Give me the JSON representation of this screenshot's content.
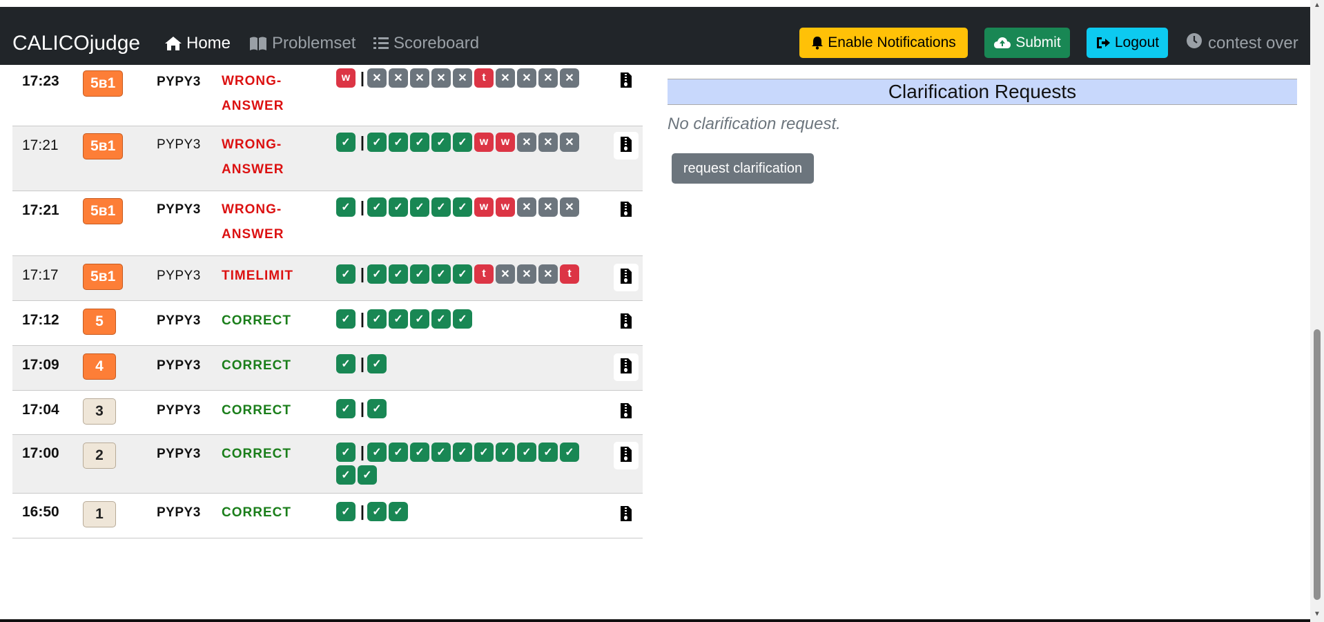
{
  "navbar": {
    "brand": "CALICOjudge",
    "home_label": "Home",
    "problemset_label": "Problemset",
    "scoreboard_label": "Scoreboard",
    "notifications_label": "Enable Notifications",
    "submit_label": "Submit",
    "logout_label": "Logout",
    "status": "contest over",
    "icons": {
      "home": "home-icon",
      "problemset": "book-icon",
      "scoreboard": "list-icon",
      "notifications": "bell-icon",
      "submit": "cloud-upload-icon",
      "logout": "sign-out-icon",
      "status": "clock-icon"
    }
  },
  "colors": {
    "navbar_bg": "#212529",
    "warning": "#ffc107",
    "success": "#198754",
    "info": "#0dcaf0",
    "problem_orange": "#fd7e37",
    "problem_beige": "#efe6d8",
    "wrong": "#dc1111",
    "correct": "#1a7e1a",
    "clarification_header": "#c8d8fc"
  },
  "submissions": {
    "rows": [
      {
        "time": "17:23",
        "problem": "5в1",
        "language": "PYPY3",
        "verdict": [
          "WRONG-",
          "ANSWER"
        ]
      },
      {
        "time": "17:21",
        "problem": "5в1",
        "language": "PYPY3",
        "verdict": [
          "WRONG-",
          "ANSWER"
        ]
      },
      {
        "time": "17:21",
        "problem": "5в1",
        "language": "PYPY3",
        "verdict": [
          "WRONG-",
          "ANSWER"
        ]
      },
      {
        "time": "17:17",
        "problem": "5в1",
        "language": "PYPY3",
        "verdict": [
          "TIMELIMIT"
        ]
      },
      {
        "time": "17:12",
        "problem": "5",
        "language": "PYPY3",
        "verdict": [
          "CORRECT"
        ]
      },
      {
        "time": "17:09",
        "problem": "4",
        "language": "PYPY3",
        "verdict": [
          "CORRECT"
        ]
      },
      {
        "time": "17:04",
        "problem": "3",
        "language": "PYPY3",
        "verdict": [
          "CORRECT"
        ]
      },
      {
        "time": "17:00",
        "problem": "2",
        "language": "PYPY3",
        "verdict": [
          "CORRECT"
        ]
      },
      {
        "time": "16:50",
        "problem": "1",
        "language": "PYPY3",
        "verdict": [
          "CORRECT"
        ]
      }
    ],
    "testcase_glyphs": {
      "ok": "✓",
      "wrong": "w",
      "timelimit": "t",
      "skipped": "✕",
      "separator": "|"
    }
  },
  "clarifications": {
    "title": "Clarification Requests",
    "empty_text": "No clarification request.",
    "request_button": "request clarification"
  }
}
